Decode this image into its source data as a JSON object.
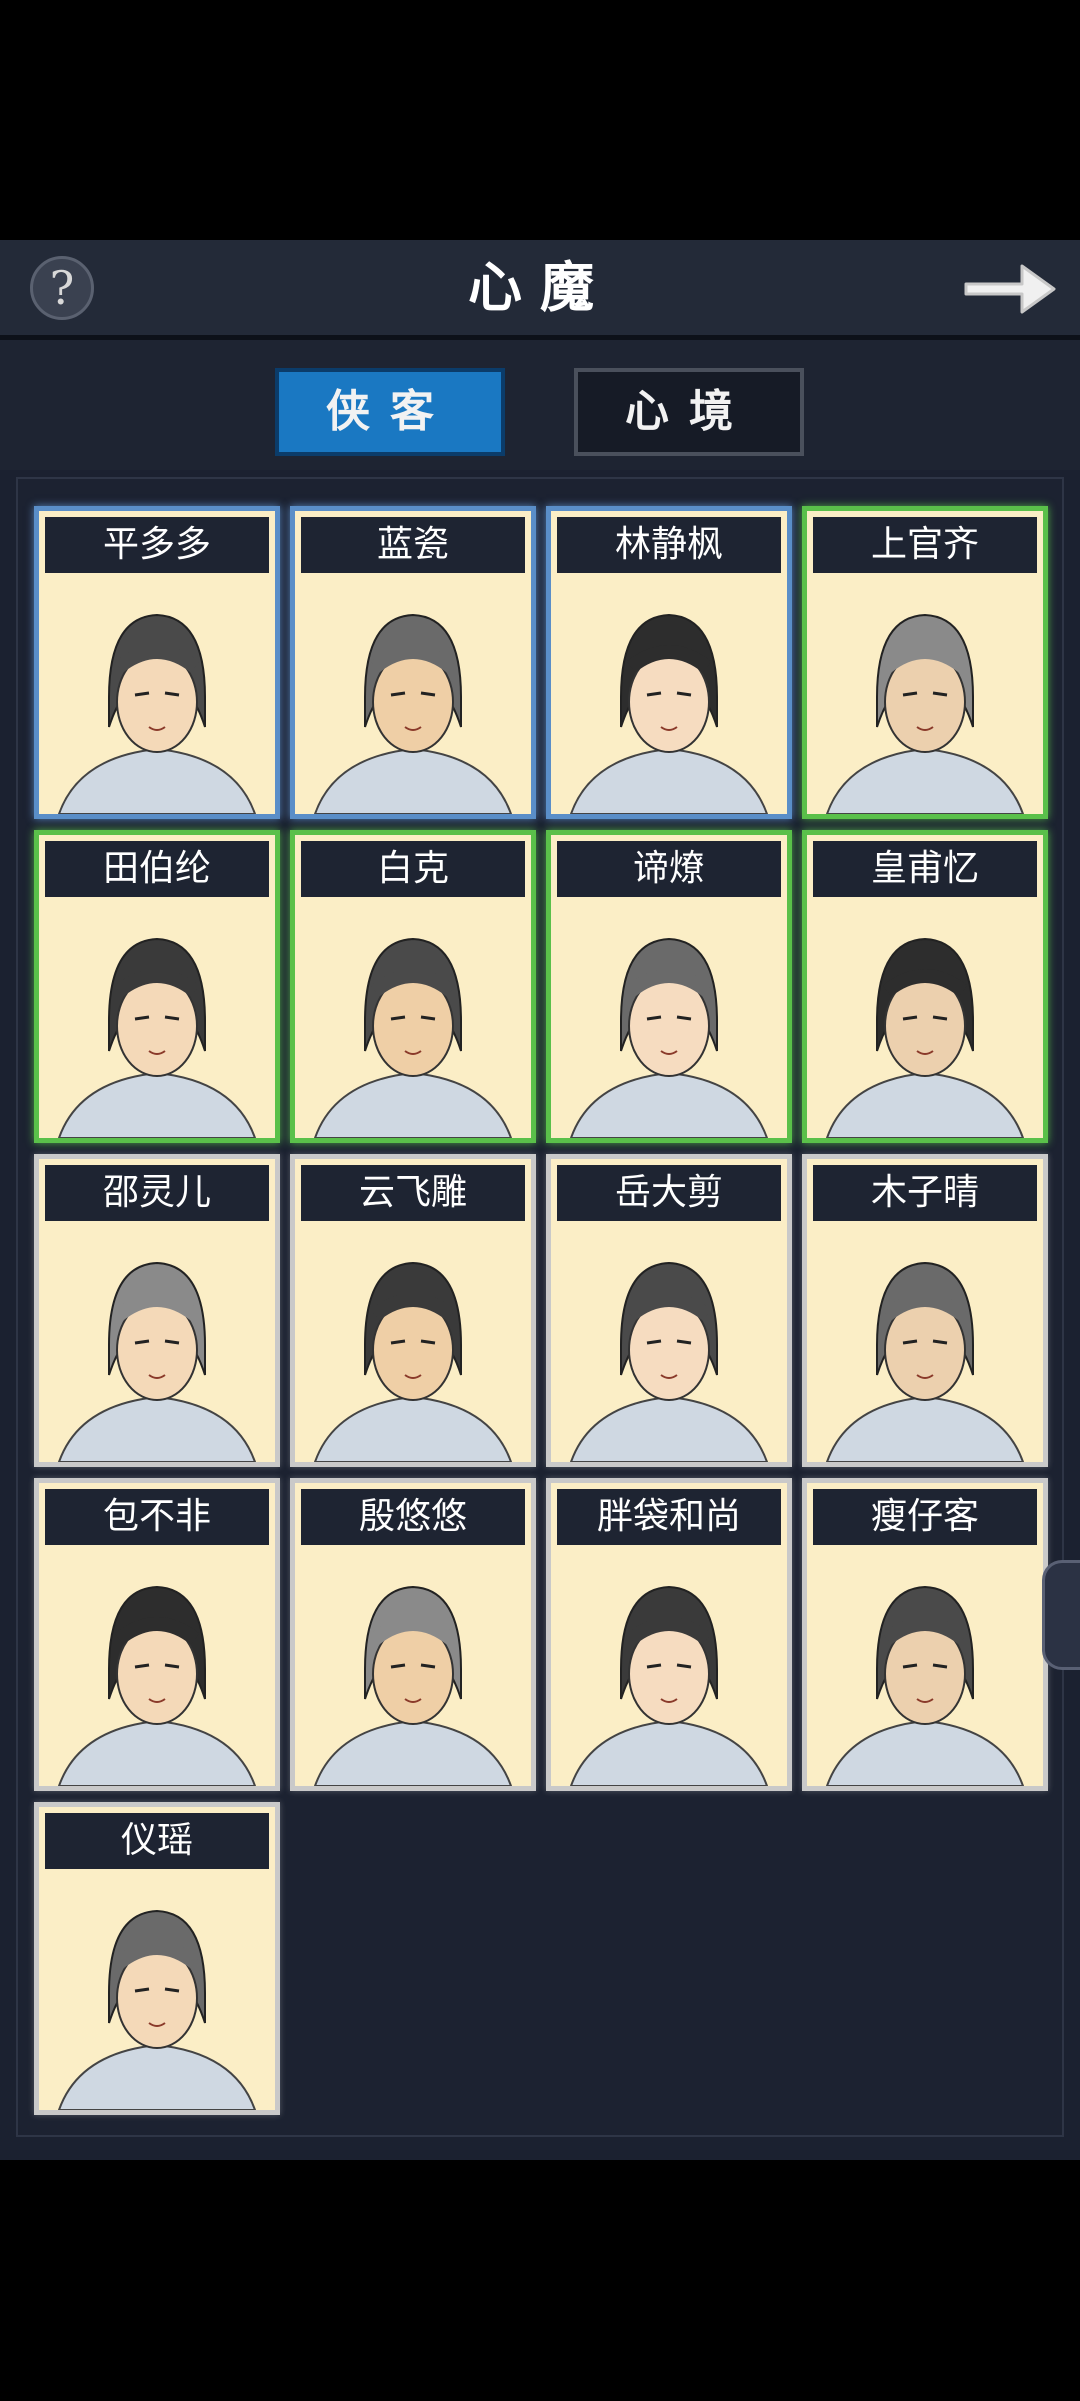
{
  "header": {
    "title": "心魔",
    "help_symbol": "?",
    "next_icon": "arrow-right-icon",
    "help_icon": "question-icon"
  },
  "tabs": [
    {
      "label": "侠客",
      "active": true
    },
    {
      "label": "心境",
      "active": false
    }
  ],
  "characters": [
    {
      "name": "平多多",
      "frame": "blue"
    },
    {
      "name": "蓝瓷",
      "frame": "blue"
    },
    {
      "name": "林静枫",
      "frame": "blue"
    },
    {
      "name": "上官齐",
      "frame": "green"
    },
    {
      "name": "田伯纶",
      "frame": "green"
    },
    {
      "name": "白克",
      "frame": "green"
    },
    {
      "name": "谛燎",
      "frame": "green"
    },
    {
      "name": "皇甫忆",
      "frame": "green"
    },
    {
      "name": "邵灵儿",
      "frame": "white"
    },
    {
      "name": "云飞雕",
      "frame": "white"
    },
    {
      "name": "岳大剪",
      "frame": "white"
    },
    {
      "name": "木子晴",
      "frame": "white"
    },
    {
      "name": "包不非",
      "frame": "white"
    },
    {
      "name": "殷悠悠",
      "frame": "white"
    },
    {
      "name": "胖袋和尚",
      "frame": "white"
    },
    {
      "name": "瘦仔客",
      "frame": "white"
    },
    {
      "name": "仪瑶",
      "frame": "white"
    }
  ],
  "colors": {
    "active_tab": "#1a78c2",
    "blue_frame": "#5a8ec8",
    "green_frame": "#5ac04a",
    "white_frame": "#c9c9c9",
    "card_bg": "#fbeec6"
  }
}
